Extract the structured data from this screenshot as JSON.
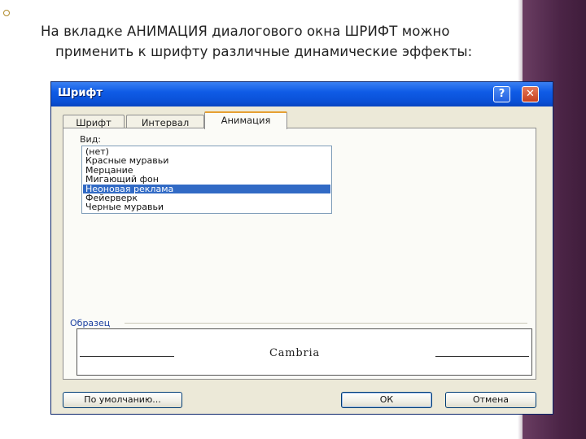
{
  "slide": {
    "line1": "На вкладке АНИМАЦИЯ диалогового окна  ШРИФТ можно",
    "line2": "применить к  шрифту различные динамические эффекты:"
  },
  "dialog": {
    "title": "Шрифт",
    "help_glyph": "?",
    "close_glyph": "✕",
    "tabs": [
      {
        "label": "Шрифт"
      },
      {
        "label": "Интервал"
      },
      {
        "label": "Анимация"
      }
    ],
    "active_tab": "Анимация",
    "view_label": "Вид:",
    "effects": [
      "(нет)",
      "Красные муравьи",
      "Мерцание",
      "Мигающий фон",
      "Неоновая реклама",
      "Фейерверк",
      "Черные муравьи"
    ],
    "selected_effect": "Неоновая реклама",
    "sample_label": "Образец",
    "sample_text": "Cambria",
    "buttons": {
      "default": "По умолчанию...",
      "ok": "ОК",
      "cancel": "Отмена"
    }
  },
  "colors": {
    "titlebar": "#0a50d6",
    "selection": "#316ac5",
    "right_band": "#4b2446"
  }
}
